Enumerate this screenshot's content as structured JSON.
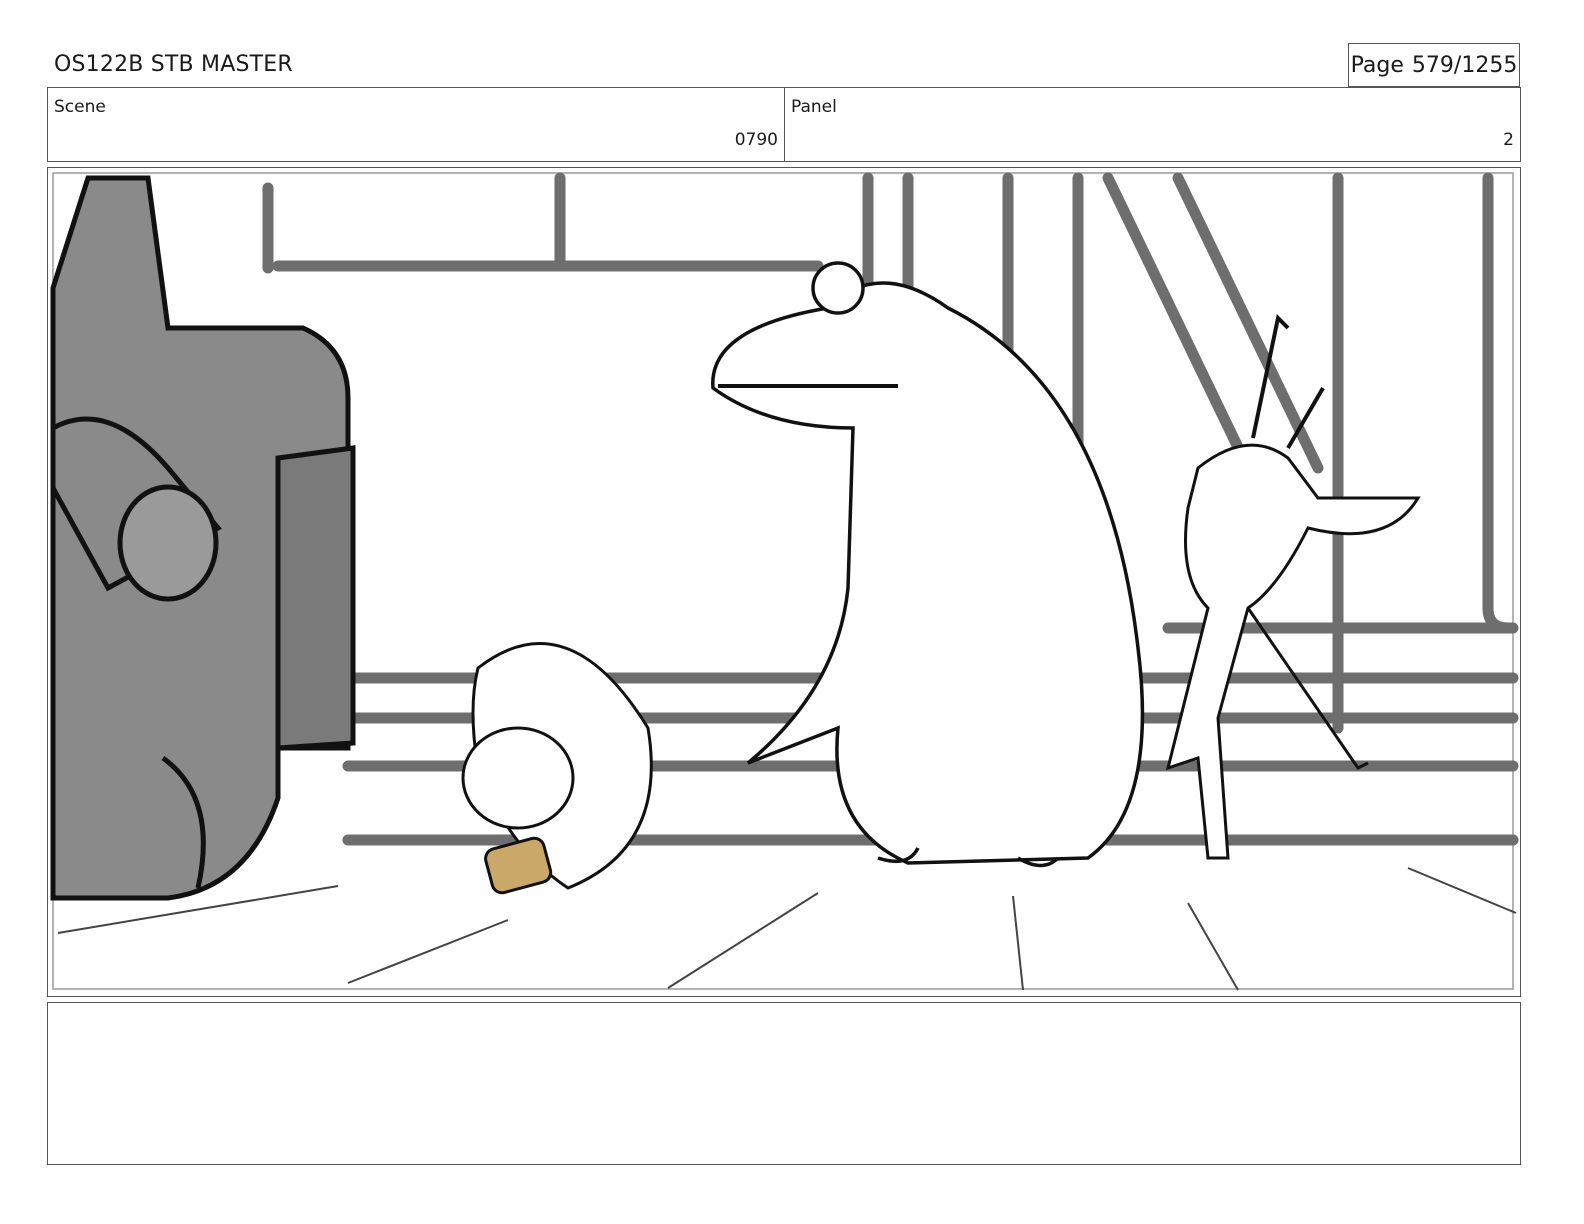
{
  "document": {
    "title": "OS122B STB MASTER",
    "page_label": "Page",
    "page_number": "579/1255"
  },
  "header": {
    "scene_label": "Scene",
    "scene_value": "0790",
    "panel_label": "Panel",
    "panel_value": "2"
  },
  "notes": {
    "text": ""
  },
  "colors": {
    "frame_border": "#555555",
    "sketch_gray": "#6e6e6e",
    "vehicle_fill": "#8a8a8a",
    "nut_accent": "#c9a86a"
  }
}
